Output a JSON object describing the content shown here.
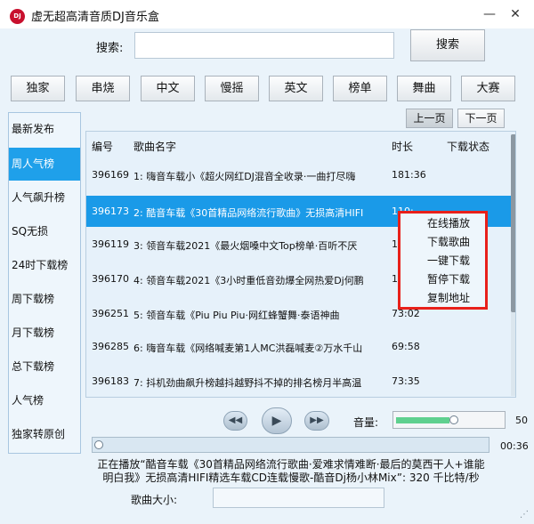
{
  "app": {
    "title": "虚无超高清音质DJ音乐盒",
    "icon_text": "DJ",
    "minimize": "—",
    "close": "✕"
  },
  "search": {
    "label": "搜索:",
    "value": "",
    "button": "搜索"
  },
  "categories": [
    "独家",
    "串烧",
    "中文",
    "慢摇",
    "英文",
    "榜单",
    "舞曲",
    "大赛"
  ],
  "sidebar": {
    "items": [
      "最新发布",
      "周人气榜",
      "人气飙升榜",
      "SQ无损",
      "24时下载榜",
      "周下载榜",
      "月下载榜",
      "总下载榜",
      "人气榜",
      "独家转原创"
    ],
    "active_index": 1
  },
  "pager": {
    "prev": "上一页",
    "next": "下一页"
  },
  "list": {
    "headers": {
      "id": "编号",
      "name": "歌曲名字",
      "duration": "时长",
      "status": "下载状态"
    },
    "rows": [
      {
        "id": "396169",
        "name": "1: 嗨音车载小《超火网红DJ混音全收录·一曲打尽嗨",
        "duration": "181:36"
      },
      {
        "id": "396173",
        "name": "2: 酷音车载《30首精品网络流行歌曲》无损高清HIFI",
        "duration": "110:"
      },
      {
        "id": "396119",
        "name": "3: 领音车载2021《最火烟嗓中文Top榜单·百听不厌",
        "duration": "1"
      },
      {
        "id": "396170",
        "name": "4: 领音车载2021《3小时重低音劲爆全网热爱Dj何鹏",
        "duration": "1"
      },
      {
        "id": "396251",
        "name": "5: 领音车载《Piu Piu Piu·网红蜂蟹舞·泰语神曲",
        "duration": "73:02"
      },
      {
        "id": "396285",
        "name": "6: 嗨音车载《网络喊麦第1人MC洪磊喊麦②万水千山",
        "duration": "69:58"
      },
      {
        "id": "396183",
        "name": "7: 抖机劲曲飙升榜越抖越野抖不掉的排名榜月半高温",
        "duration": "73:35"
      }
    ],
    "selected_index": 1
  },
  "context_menu": {
    "items": [
      "在线播放",
      "下载歌曲",
      "一键下载",
      "暂停下载",
      "复制地址"
    ]
  },
  "player": {
    "prev_icon": "◀◀",
    "play_icon": "▶",
    "next_icon": "▶▶",
    "volume_label": "音量:",
    "volume_value": "50",
    "volume_level": 0.5,
    "position_time": "00:36",
    "progress": 0.0,
    "now_playing": "正在播放“酷音车载《30首精品网络流行歌曲·爱难求情难断·最后的莫西干人+谁能明白我》无损高清HIFI精选车载CD连载慢歌-酷音Dj杨小林Mix”: 320 千比特/秒"
  },
  "song_size": {
    "label": "歌曲大小:",
    "value": ""
  },
  "colors": {
    "accent": "#1fa0ea",
    "selected_row": "#1a9ae8",
    "menu_border": "#e8201a",
    "volume_fill": "#5fd08f"
  }
}
